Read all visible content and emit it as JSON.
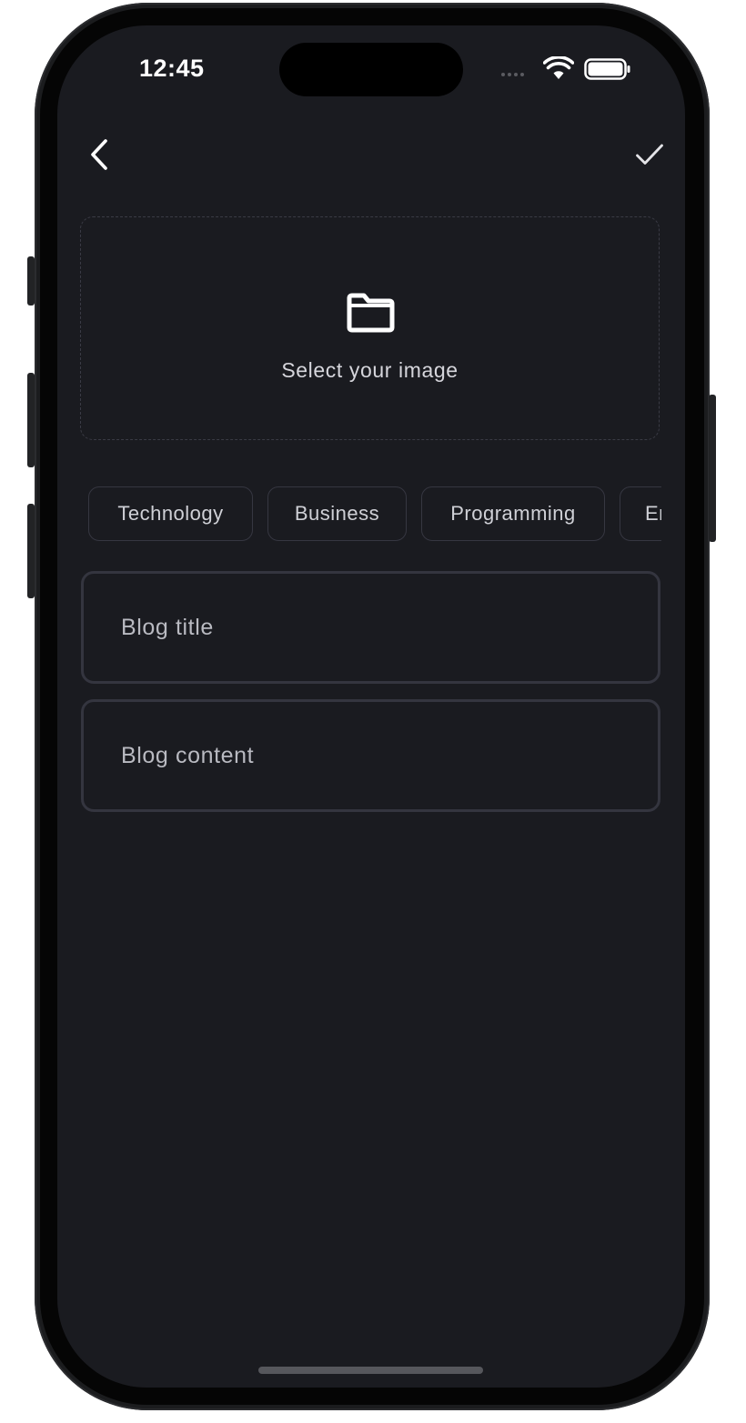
{
  "status_bar": {
    "time": "12:45"
  },
  "nav": {
    "back_icon": "chevron-left-icon",
    "confirm_icon": "checkmark-icon"
  },
  "image_picker": {
    "icon": "folder-icon",
    "label": "Select your image"
  },
  "categories": [
    {
      "label": "Technology"
    },
    {
      "label": "Business"
    },
    {
      "label": "Programming"
    },
    {
      "label": "En"
    }
  ],
  "form": {
    "title_placeholder": "Blog title",
    "content_placeholder": "Blog content"
  },
  "colors": {
    "screen_background": "#1a1b20",
    "border": "#34353f",
    "text": "#d6d6dc"
  }
}
